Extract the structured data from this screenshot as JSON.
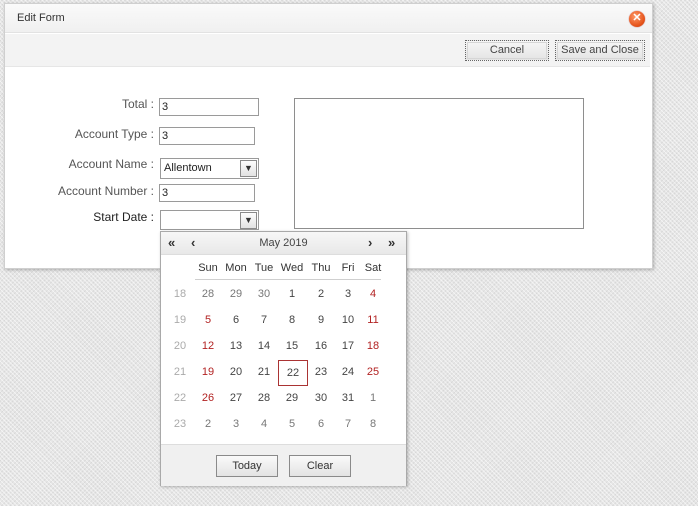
{
  "dialog": {
    "title": "Edit Form",
    "close_icon": "close-icon",
    "toolbar": {
      "cancel_label": "Cancel",
      "save_close_label": "Save and Close"
    }
  },
  "form": {
    "total": {
      "label": "Total :",
      "value": "3"
    },
    "account_type": {
      "label": "Account Type :",
      "value": "3"
    },
    "account_name": {
      "label": "Account Name :",
      "value": "Allentown"
    },
    "account_number": {
      "label": "Account Number :",
      "value": "3"
    },
    "start_date": {
      "label": "Start Date :",
      "value": ""
    }
  },
  "calendar": {
    "title": "May 2019",
    "nav": {
      "prev_year": "«",
      "prev_month": "‹",
      "next_month": "›",
      "next_year": "»"
    },
    "weekdays": [
      "Sun",
      "Mon",
      "Tue",
      "Wed",
      "Thu",
      "Fri",
      "Sat"
    ],
    "weeks": [
      {
        "num": "18",
        "days": [
          "28",
          "29",
          "30",
          "1",
          "2",
          "3",
          "4"
        ]
      },
      {
        "num": "19",
        "days": [
          "5",
          "6",
          "7",
          "8",
          "9",
          "10",
          "11"
        ]
      },
      {
        "num": "20",
        "days": [
          "12",
          "13",
          "14",
          "15",
          "16",
          "17",
          "18"
        ]
      },
      {
        "num": "21",
        "days": [
          "19",
          "20",
          "21",
          "22",
          "23",
          "24",
          "25"
        ]
      },
      {
        "num": "22",
        "days": [
          "26",
          "27",
          "28",
          "29",
          "30",
          "31",
          "1"
        ]
      },
      {
        "num": "23",
        "days": [
          "2",
          "3",
          "4",
          "5",
          "6",
          "7",
          "8"
        ]
      }
    ],
    "today_label": "Today",
    "clear_label": "Clear"
  },
  "colors": {
    "weekend": "#b22222",
    "close": "#e5531a"
  }
}
